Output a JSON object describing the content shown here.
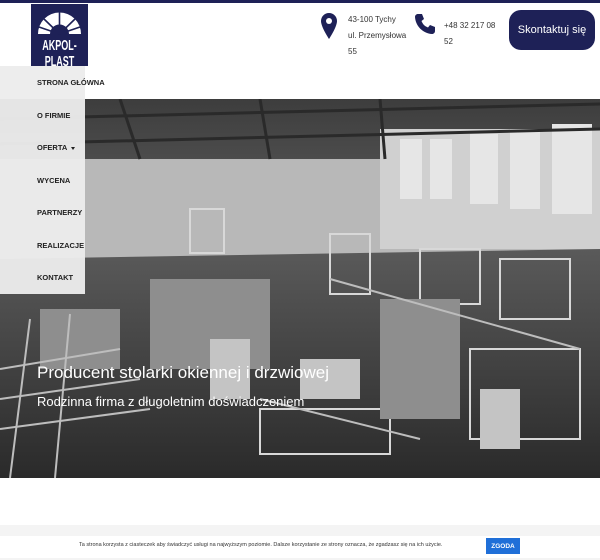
{
  "header": {
    "logo_text": "AKPOL-PLAST",
    "address_line1": "43-100 Tychy",
    "address_line2": "ul. Przemysłowa 55",
    "phone": "+48 32 217 08 52",
    "contact_button": "Skontaktuj się"
  },
  "nav": {
    "items": [
      {
        "label": "STRONA GŁÓWNA"
      },
      {
        "label": "O FIRMIE"
      },
      {
        "label": "OFERTA"
      },
      {
        "label": "WYCENA"
      },
      {
        "label": "PARTNERZY"
      },
      {
        "label": "REALIZACJE"
      },
      {
        "label": "KONTAKT"
      }
    ]
  },
  "hero": {
    "title": "Producent stolarki okiennej i drzwiowej",
    "subtitle": "Rodzinna firma z długoletnim doświadczeniem"
  },
  "cookie": {
    "text": "Ta strona korzysta z ciasteczek aby świadczyć usługi na najwyższym poziomie. Dalsze korzystanie ze strony oznacza, że zgadzasz się na ich użycie.",
    "button": "ZGODA"
  },
  "colors": {
    "brand": "#1e2157",
    "cookie_button": "#1f6fd8"
  }
}
